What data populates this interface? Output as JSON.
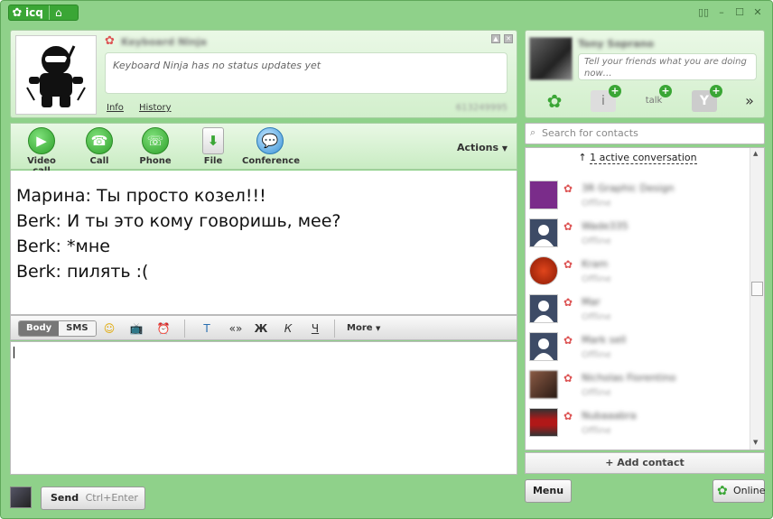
{
  "titlebar": {
    "app_name": "icq"
  },
  "profile": {
    "name": "Keyboard Ninja",
    "status_placeholder": "Keyboard Ninja has no status updates yet",
    "info_link": "Info",
    "history_link": "History",
    "uin": "613249995"
  },
  "toolbar": {
    "video_call": "Video call",
    "call": "Call",
    "phone": "Phone",
    "file": "File",
    "conference": "Conference",
    "actions": "Actions"
  },
  "messages": [
    "Марина: Ты просто козел!!!",
    "Berk: И ты это кому говоришь, мее?",
    "Berk: *мне",
    "Berk: пилять :("
  ],
  "format_bar": {
    "body": "Body",
    "sms": "SMS",
    "quote": "«»",
    "bold": "Ж",
    "italic": "К",
    "underline": "Ч",
    "more": "More"
  },
  "send": {
    "label": "Send",
    "shortcut": "Ctrl+Enter"
  },
  "me": {
    "name": "Tony Soprano",
    "status_placeholder": "Tell your friends what you are doing now…"
  },
  "search": {
    "placeholder": "Search for contacts"
  },
  "contacts": {
    "active_conversation": "1 active conversation",
    "items": [
      {
        "name": "3R Graphic Design",
        "status": "Offline",
        "color": "#7a2c8a"
      },
      {
        "name": "Wade335",
        "status": "Offline",
        "color": "#ffffff"
      },
      {
        "name": "Kram",
        "status": "Offline",
        "color": "#c22a10"
      },
      {
        "name": "Mar",
        "status": "Offline",
        "color": "#ffffff"
      },
      {
        "name": "Mark sell",
        "status": "Offline",
        "color": "#ffffff"
      },
      {
        "name": "Nicholas Fiorentino",
        "status": "Offline",
        "color": "#5a3a2e"
      },
      {
        "name": "Nubaaabra",
        "status": "Offline",
        "color": "#b01818"
      }
    ],
    "add_contact": "Add contact"
  },
  "menu_button": "Menu",
  "online_button": "Online"
}
